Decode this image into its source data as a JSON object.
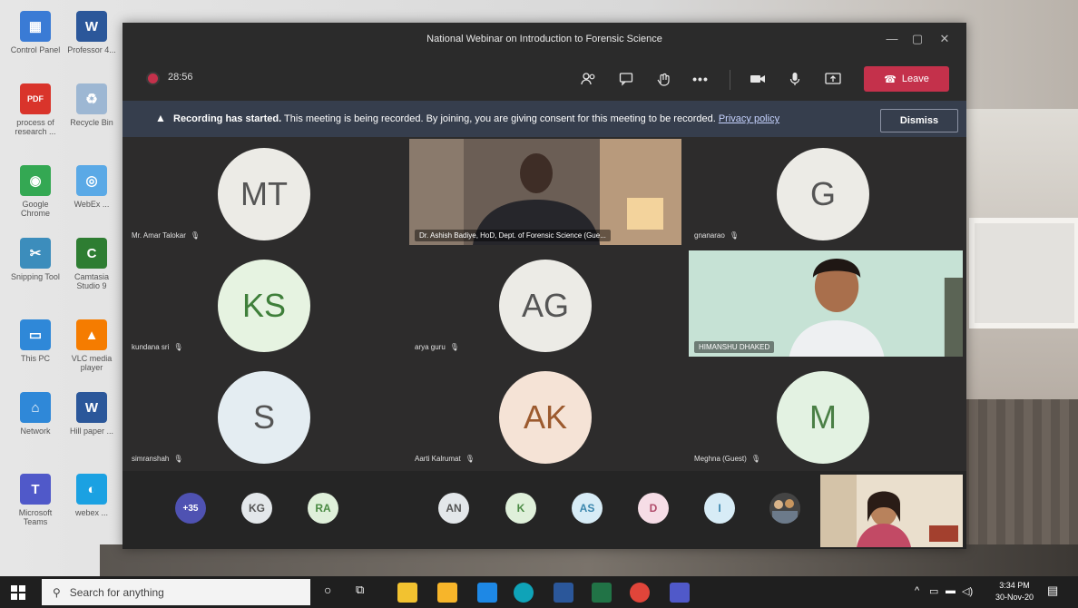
{
  "desktop": {
    "icons": [
      {
        "label": "Control Panel",
        "icon": "control-panel-icon",
        "color": "#3a7bd5",
        "glyph": "▦"
      },
      {
        "label": "Professor 4...",
        "icon": "word-doc-icon",
        "color": "#2b579a",
        "glyph": "W"
      },
      {
        "label": "process of research ...",
        "icon": "pdf-icon",
        "color": "#d9342b",
        "glyph": "PDF"
      },
      {
        "label": "Recycle Bin",
        "icon": "recycle-bin-icon",
        "color": "#9db7d3",
        "glyph": "♻"
      },
      {
        "label": "Google Chrome",
        "icon": "chrome-icon",
        "color": "#34a853",
        "glyph": "◉"
      },
      {
        "label": "WebEx ...",
        "icon": "webex-icon",
        "color": "#5aa9e6",
        "glyph": "◎"
      },
      {
        "label": "Snipping Tool",
        "icon": "snipping-tool-icon",
        "color": "#3c8dbc",
        "glyph": "✂"
      },
      {
        "label": "Camtasia Studio 9",
        "icon": "camtasia-icon",
        "color": "#2e7d32",
        "glyph": "C"
      },
      {
        "label": "This PC",
        "icon": "this-pc-icon",
        "color": "#2f88d8",
        "glyph": "▭"
      },
      {
        "label": "VLC media player",
        "icon": "vlc-icon",
        "color": "#f57c00",
        "glyph": "▲"
      },
      {
        "label": "Network",
        "icon": "network-icon",
        "color": "#2f88d8",
        "glyph": "⌂"
      },
      {
        "label": "Hill paper ...",
        "icon": "word-doc-icon",
        "color": "#2b579a",
        "glyph": "W"
      },
      {
        "label": "Microsoft Teams",
        "icon": "teams-icon",
        "color": "#5059c9",
        "glyph": "T"
      },
      {
        "label": "webex ...",
        "icon": "webex-meet-icon",
        "color": "#1ba1e2",
        "glyph": "◐"
      }
    ]
  },
  "teams": {
    "title": "National Webinar on Introduction to Forensic Science",
    "timer": "28:56",
    "leave_label": "Leave",
    "banner": {
      "bold": "Recording has started.",
      "text": " This meeting is being recorded. By joining, you are giving consent for this meeting to be recorded. ",
      "link": "Privacy policy",
      "dismiss": "Dismiss"
    },
    "participants": [
      {
        "initials": "MT",
        "name": "Mr. Amar Talokar",
        "color": "#ecebe6"
      },
      {
        "video": true,
        "name": "Dr. Ashish Badiye, HoD, Dept. of Forensic Science (Gue..."
      },
      {
        "initials": "G",
        "name": "gnanarao",
        "color": "#ecebe6"
      },
      {
        "initials": "KS",
        "name": "kundana sri",
        "color": "#e6f3e1"
      },
      {
        "initials": "AG",
        "name": "arya guru",
        "color": "#ecebe6"
      },
      {
        "video": true,
        "name": "HIMANSHU DHAKED"
      },
      {
        "initials": "S",
        "name": "simranshah",
        "color": "#e4edf2"
      },
      {
        "initials": "AK",
        "name": "Aarti Kalrumat",
        "color": "#f5e3d6"
      },
      {
        "initials": "M",
        "name": "Meghna (Guest)",
        "color": "#e3f2e2"
      }
    ],
    "overflow": [
      {
        "initials": "+35",
        "color": "#4f52b2",
        "text_color": "#ffffff"
      },
      {
        "initials": "KG",
        "color": "#e3e7ea",
        "text_color": "#555555"
      },
      {
        "initials": "RA",
        "color": "#dff0da",
        "text_color": "#4a8a43"
      },
      {
        "initials": "AN",
        "color": "#e3e7ea",
        "text_color": "#555555"
      },
      {
        "initials": "K",
        "color": "#dff0da",
        "text_color": "#4a8a43"
      },
      {
        "initials": "AS",
        "color": "#d7ecf6",
        "text_color": "#3a86ad"
      },
      {
        "initials": "D",
        "color": "#f6dde6",
        "text_color": "#b04a6a"
      },
      {
        "initials": "I",
        "color": "#d7ecf6",
        "text_color": "#3a86ad"
      }
    ]
  },
  "taskbar": {
    "search_placeholder": "Search for anything",
    "time": "3:34 PM",
    "date": "30-Nov-20"
  }
}
